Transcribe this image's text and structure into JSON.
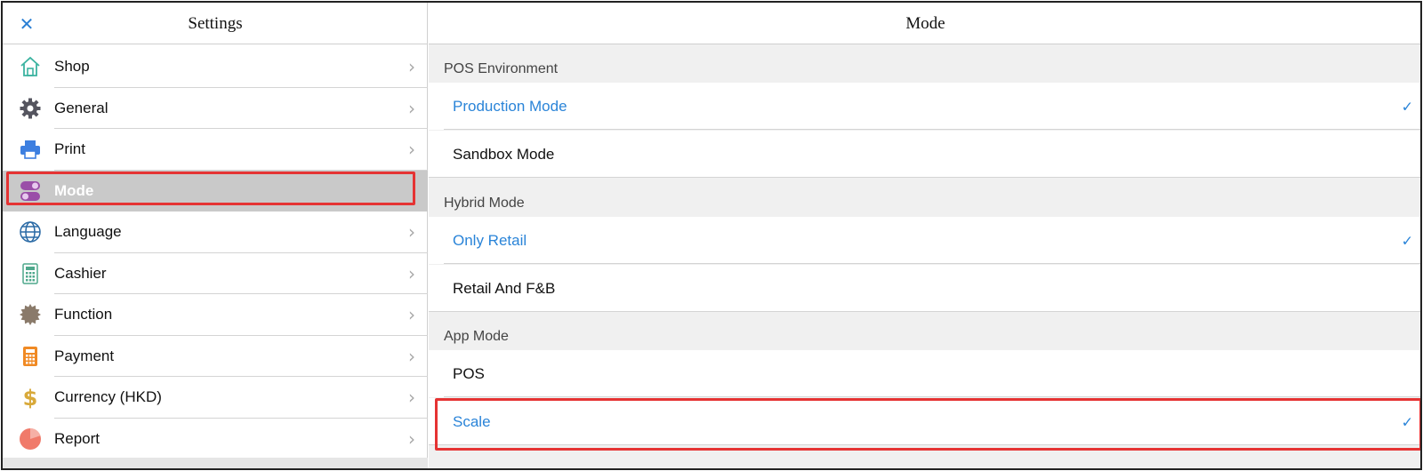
{
  "sidebar": {
    "title": "Settings",
    "close_icon": "close-icon",
    "items": [
      {
        "label": "Shop",
        "icon": "shop-icon"
      },
      {
        "label": "General",
        "icon": "gear-icon"
      },
      {
        "label": "Print",
        "icon": "printer-icon"
      },
      {
        "label": "Mode",
        "icon": "toggle-icon",
        "selected": true
      },
      {
        "label": "Language",
        "icon": "globe-icon"
      },
      {
        "label": "Cashier",
        "icon": "calculator-icon"
      },
      {
        "label": "Function",
        "icon": "badge-icon"
      },
      {
        "label": "Payment",
        "icon": "calculator-icon"
      },
      {
        "label": "Currency (HKD)",
        "icon": "dollar-icon"
      },
      {
        "label": "Report",
        "icon": "pie-chart-icon"
      }
    ]
  },
  "main": {
    "title": "Mode",
    "sections": [
      {
        "label": "POS Environment",
        "options": [
          {
            "label": "Production Mode",
            "checked": true
          },
          {
            "label": "Sandbox Mode",
            "checked": false
          }
        ]
      },
      {
        "label": "Hybrid Mode",
        "options": [
          {
            "label": "Only Retail",
            "checked": true
          },
          {
            "label": "Retail And F&B",
            "checked": false
          }
        ]
      },
      {
        "label": "App Mode",
        "options": [
          {
            "label": "POS",
            "checked": false
          },
          {
            "label": "Scale",
            "checked": true
          }
        ]
      }
    ]
  },
  "glyphs": {
    "close": "✕",
    "chevron": "›",
    "check": "✓"
  },
  "colors": {
    "accent": "#2a84d8",
    "highlight": "#e53333",
    "selected_bg": "#c9c9c9"
  }
}
